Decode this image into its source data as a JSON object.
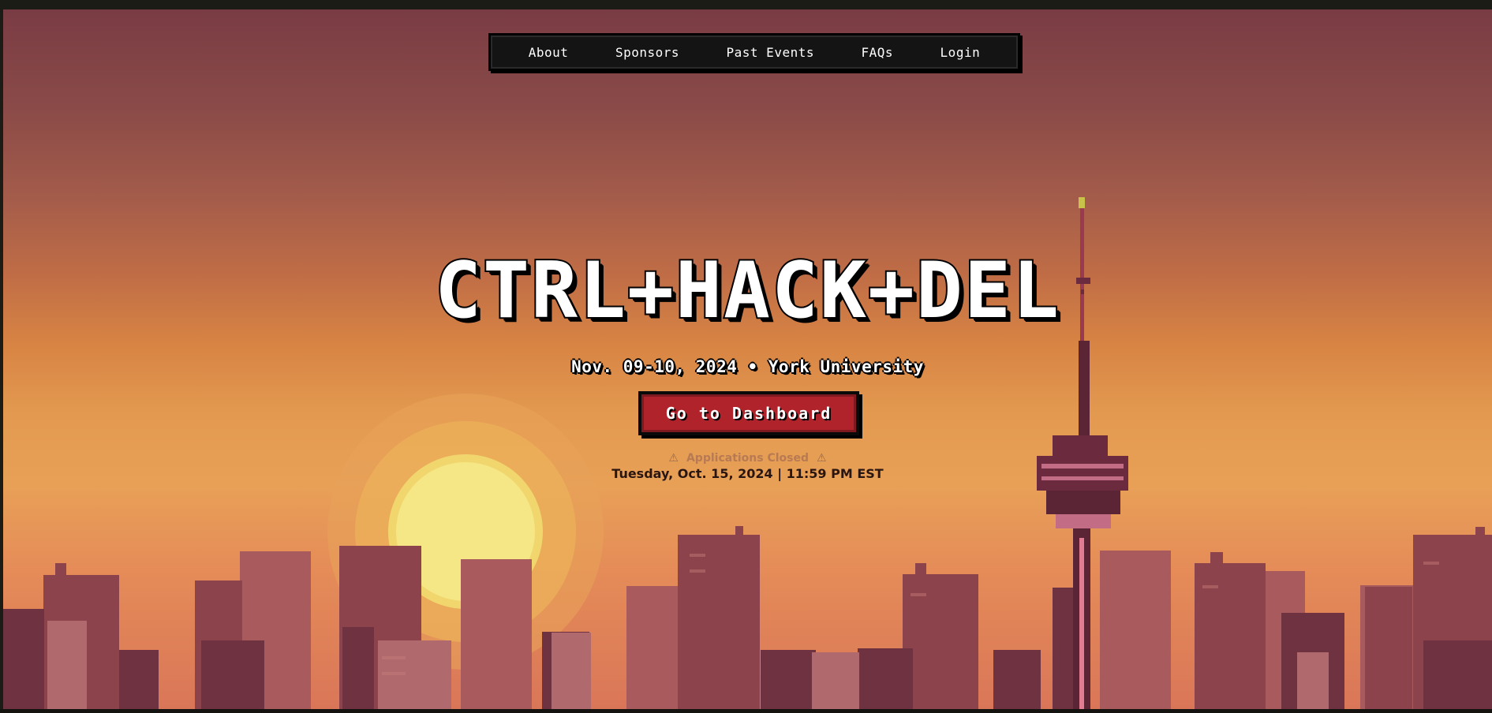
{
  "nav": {
    "items": [
      {
        "label": "About"
      },
      {
        "label": "Sponsors"
      },
      {
        "label": "Past Events"
      },
      {
        "label": "FAQs"
      },
      {
        "label": "Login"
      }
    ]
  },
  "hero": {
    "title": "CTRL+HACK+DEL",
    "subtitle": "Nov. 09-10, 2024 • York University",
    "cta_label": "Go to Dashboard",
    "status_text": "Applications Closed",
    "deadline": "Tuesday, Oct. 15, 2024 | 11:59 PM EST"
  },
  "icons": {
    "status_left": "warning-icon",
    "status_right": "warning-icon"
  },
  "colors": {
    "cta_background": "#b0232b",
    "nav_background": "#141414",
    "sky_top": "#7a3c44",
    "sky_horizon": "#e39a50"
  }
}
